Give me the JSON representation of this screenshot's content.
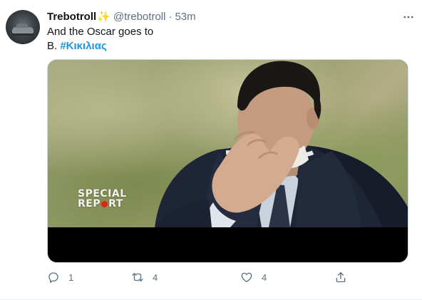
{
  "tweet": {
    "author": {
      "display_name": "Trebotroll",
      "emoji": "✨",
      "handle": "@trebotroll",
      "separator": "·",
      "time": "53m"
    },
    "text": {
      "line1": "And the Oscar goes to",
      "line2_prefix": "Β. ",
      "hashtag": "#Κικιλιας"
    },
    "media": {
      "type": "video",
      "overlay_badge": {
        "line1": "SPECIAL",
        "line2_a": "REP",
        "line2_b": "RT"
      }
    },
    "actions": {
      "reply_count": "1",
      "retweet_count": "4",
      "like_count": "4"
    }
  },
  "icons": {
    "more": "more-icon",
    "reply": "reply-icon",
    "retweet": "retweet-icon",
    "like": "heart-icon",
    "share": "share-icon"
  },
  "colors": {
    "text_primary": "#0f1419",
    "text_secondary": "#5b7083",
    "link": "#1b95e0",
    "badge_dot": "#e0221a",
    "border": "#cfd9de"
  }
}
